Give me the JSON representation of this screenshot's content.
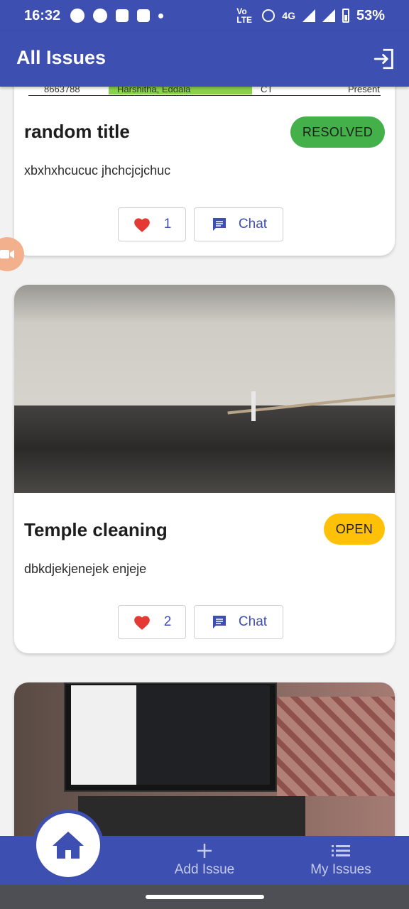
{
  "status_bar": {
    "time": "16:32",
    "network_label": "Vo LTE",
    "network_type": "4G",
    "battery": "53%"
  },
  "app_bar": {
    "title": "All Issues",
    "logout_icon": "logout-icon"
  },
  "partial_row": {
    "phone": "8663788",
    "name": "Harshitha, Eddala",
    "dept": "CT",
    "status": "Present"
  },
  "issues": [
    {
      "title": "random title",
      "description": "xbxhxhcucuc jhchcjcjchuc",
      "status": "RESOLVED",
      "likes": "1",
      "chat_label": "Chat"
    },
    {
      "title": "Temple cleaning",
      "description": "dbkdjekjenejek enjeje",
      "status": "OPEN",
      "likes": "2",
      "chat_label": "Chat"
    }
  ],
  "bottom_nav": {
    "home_icon": "home-icon",
    "add_issue_label": "Add Issue",
    "my_issues_label": "My Issues"
  },
  "colors": {
    "primary": "#3d4fb0",
    "resolved": "#43b04a",
    "open": "#ffc107",
    "like": "#e53935"
  }
}
